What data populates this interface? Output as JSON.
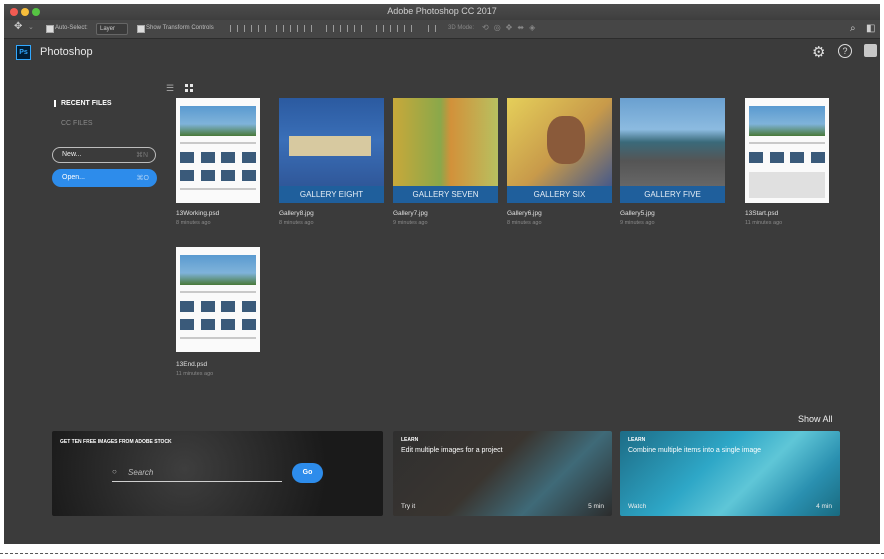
{
  "window": {
    "title": "Adobe Photoshop CC 2017"
  },
  "options_bar": {
    "auto_select_label": "Auto-Select:",
    "auto_select_value": "Layer",
    "show_transform_label": "Show Transform Controls",
    "mode_label": "3D Mode:"
  },
  "app": {
    "logo": "Ps",
    "name": "Photoshop"
  },
  "sidebar": {
    "recent_files": "RECENT FILES",
    "cc_files": "CC FILES",
    "new_button": "New...",
    "new_shortcut": "⌘N",
    "open_button": "Open...",
    "open_shortcut": "⌘O"
  },
  "files": [
    {
      "name": "13Working.psd",
      "time": "8 minutes ago"
    },
    {
      "name": "Gallery8.jpg",
      "time": "8 minutes ago",
      "band": "GALLERY EIGHT"
    },
    {
      "name": "Gallery7.jpg",
      "time": "9 minutes ago",
      "band": "GALLERY SEVEN"
    },
    {
      "name": "Gallery6.jpg",
      "time": "8 minutes ago",
      "band": "GALLERY SIX"
    },
    {
      "name": "Gallery5.jpg",
      "time": "9 minutes ago",
      "band": "GALLERY FIVE"
    },
    {
      "name": "13Start.psd",
      "time": "11 minutes ago"
    },
    {
      "name": "13End.psd",
      "time": "11 minutes ago"
    }
  ],
  "learn": {
    "show_all": "Show All",
    "stock_caption": "GET TEN FREE IMAGES FROM ADOBE STOCK",
    "search_placeholder": "Search",
    "go_button": "Go",
    "card2_tag": "LEARN",
    "card2_title": "Edit multiple images for a project",
    "card2_action": "Try it",
    "card2_duration": "5 min",
    "card3_tag": "LEARN",
    "card3_title": "Combine multiple items into a single image",
    "card3_action": "Watch",
    "card3_duration": "4 min"
  },
  "colors": {
    "accent": "#2d8ceb",
    "band": "#1f5f9c",
    "background": "#3b3b3b"
  }
}
